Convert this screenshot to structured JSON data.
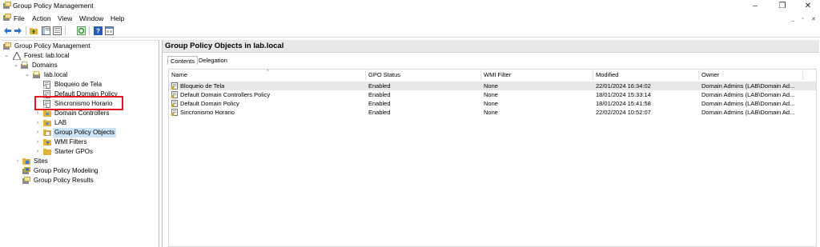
{
  "window": {
    "title": "Group Policy Management",
    "minimize_glyph": "–",
    "maximize_glyph": "❐",
    "close_glyph": "✕"
  },
  "menu": {
    "items": [
      "File",
      "Action",
      "View",
      "Window",
      "Help"
    ],
    "mdi_minimize": "_",
    "mdi_restore": "▫",
    "mdi_close": "✕"
  },
  "toolbar": {
    "buttons": [
      "back-icon",
      "forward-icon",
      "folder-up-icon",
      "show-hide-tree-icon",
      "refresh-icon",
      "help-icon",
      "properties-icon"
    ]
  },
  "tree": {
    "root": "Group Policy Management",
    "forest": "Forest: lab.local",
    "domains": "Domains",
    "domain": "lab.local",
    "links": [
      "Bloqueio de Tela",
      "Default Domain Policy",
      "Sincronismo Horario"
    ],
    "ou_dc": "Domain Controllers",
    "ou_lab": "LAB",
    "gpo_container": "Group Policy Objects",
    "wmi": "WMI Filters",
    "starter": "Starter GPOs",
    "sites": "Sites",
    "modeling": "Group Policy Modeling",
    "results": "Group Policy Results"
  },
  "right": {
    "title": "Group Policy Objects in lab.local",
    "tabs": [
      "Contents",
      "Delegation"
    ],
    "columns": [
      "Name",
      "GPO Status",
      "WMI Filter",
      "Modified",
      "Owner"
    ],
    "rows": [
      {
        "name": "Bloqueio de Tela",
        "status": "Enabled",
        "wmi": "None",
        "modified": "22/01/2024 16:34:02",
        "owner": "Domain Admins (LAB\\Domain Ad..."
      },
      {
        "name": "Default Domain Controllers Policy",
        "status": "Enabled",
        "wmi": "None",
        "modified": "18/01/2024 15:33:14",
        "owner": "Domain Admins (LAB\\Domain Ad..."
      },
      {
        "name": "Default Domain Policy",
        "status": "Enabled",
        "wmi": "None",
        "modified": "18/01/2024 15:41:58",
        "owner": "Domain Admins (LAB\\Domain Ad..."
      },
      {
        "name": "Sincronismo Horario",
        "status": "Enabled",
        "wmi": "None",
        "modified": "22/02/2024 10:52:07",
        "owner": "Domain Admins (LAB\\Domain Ad..."
      }
    ]
  },
  "colors": {
    "selection": "#cce4f7",
    "highlight_box": "#e8171f",
    "header_bg": "#e8e8e8"
  }
}
